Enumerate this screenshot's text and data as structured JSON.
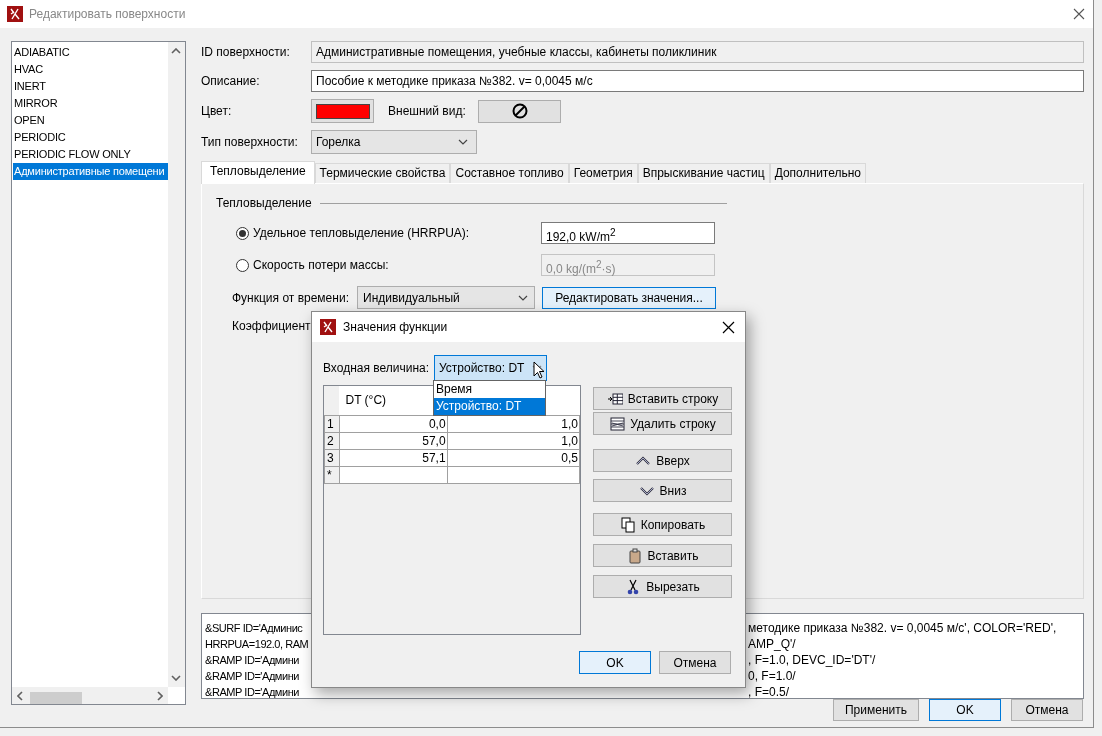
{
  "window": {
    "title": "Редактировать поверхности"
  },
  "surface_list": {
    "items": [
      {
        "label": "ADIABATIC",
        "selected": false
      },
      {
        "label": "HVAC",
        "selected": false
      },
      {
        "label": "INERT",
        "selected": false
      },
      {
        "label": "MIRROR",
        "selected": false
      },
      {
        "label": "OPEN",
        "selected": false
      },
      {
        "label": "PERIODIC",
        "selected": false
      },
      {
        "label": "PERIODIC FLOW ONLY",
        "selected": false
      },
      {
        "label": "Административные помещени",
        "selected": true
      }
    ]
  },
  "form": {
    "id_label": "ID поверхности:",
    "id_value": "Административные помещения, учебные классы, кабинеты поликлиник",
    "description_label": "Описание:",
    "description_value": "Пособие к методике приказа №382. v= 0,0045 м/с",
    "color_label": "Цвет:",
    "color": "#ff0000",
    "appearance_label": "Внешний вид:",
    "type_label": "Тип поверхности:",
    "type_value": "Горелка"
  },
  "tabs": [
    {
      "label": "Тепловыделение",
      "selected": true
    },
    {
      "label": "Термические свойства",
      "selected": false
    },
    {
      "label": "Составное топливо",
      "selected": false
    },
    {
      "label": "Геометрия",
      "selected": false
    },
    {
      "label": "Впрыскивание частиц",
      "selected": false
    },
    {
      "label": "Дополнительно",
      "selected": false
    }
  ],
  "heat_release": {
    "group_title": "Тепловыделение",
    "options": [
      {
        "label": "Удельное тепловыделение (HRRPUA):",
        "selected": true,
        "value": "192,0 kW/m$^{2}$",
        "disabled": false
      },
      {
        "label": "Скорость потери массы:",
        "selected": false,
        "value": "0,0 kg/(m$^{2}$·s)",
        "disabled": true
      }
    ],
    "time_function_label": "Функция от времени:",
    "time_function_value": "Индивидуальный",
    "edit_button": "Редактировать значения...",
    "coefficient_label": "Коэффициент"
  },
  "fds_text": {
    "left_lines": [
      "&SURF ID='Админис",
      "HRRPUA=192.0, RAM",
      "&RAMP ID='Админи",
      "&RAMP ID='Админи",
      "&RAMP ID='Админи"
    ],
    "right_lines": [
      "методике приказа №382. v= 0,0045 м/с', COLOR='RED',",
      "AMP_Q'/",
      ", F=1.0, DEVC_ID='DT'/",
      "0, F=1.0/",
      ", F=0.5/"
    ]
  },
  "buttons": [
    {
      "label": "Применить",
      "default": false
    },
    {
      "label": "OK",
      "default": true
    },
    {
      "label": "Отмена",
      "default": false
    }
  ],
  "dialog": {
    "title": "Значения функции",
    "input_label": "Входная величина:",
    "input_value": "Устройство: DT",
    "dropdown_options": [
      {
        "label": "Время",
        "selected": false
      },
      {
        "label": "Устройство: DT",
        "selected": true
      }
    ],
    "table": {
      "columns": [
        "DT (°C)"
      ],
      "rows": [
        {
          "index": "1",
          "cells": [
            "0,0",
            "1,0"
          ]
        },
        {
          "index": "2",
          "cells": [
            "57,0",
            "1,0"
          ]
        },
        {
          "index": "3",
          "cells": [
            "57,1",
            "0,5"
          ]
        }
      ],
      "new_row_marker": "*"
    },
    "side_buttons": [
      {
        "label": "Вставить строку",
        "kind": "insert-row"
      },
      {
        "label": "Удалить строку",
        "kind": "delete-row"
      },
      {
        "label": "Вверх",
        "kind": "up"
      },
      {
        "label": "Вниз",
        "kind": "down"
      },
      {
        "label": "Копировать",
        "kind": "copy"
      },
      {
        "label": "Вставить",
        "kind": "paste"
      },
      {
        "label": "Вырезать",
        "kind": "cut"
      }
    ],
    "buttons": [
      {
        "label": "OK",
        "default": true
      },
      {
        "label": "Отмена",
        "default": false
      }
    ]
  }
}
